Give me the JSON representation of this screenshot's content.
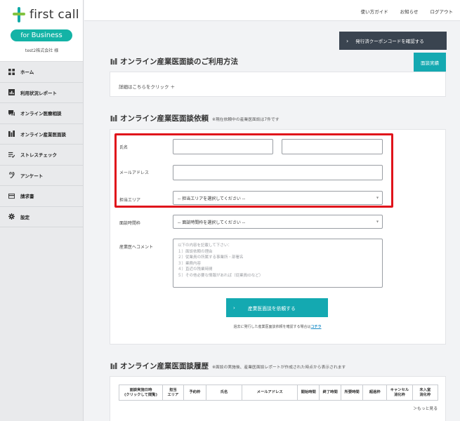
{
  "brand": {
    "name": "first call",
    "badge_prefix": "for",
    "badge_word": "Business",
    "company": "test2株式会社 様"
  },
  "colors": {
    "teal": "#14a9b1",
    "dark_button": "#3a4450",
    "highlight": "#e0131b",
    "link": "#1f8fc9"
  },
  "sidebar": {
    "items": [
      {
        "label": "ホーム",
        "icon": "grid-icon"
      },
      {
        "label": "利用状況レポート",
        "icon": "report-icon"
      },
      {
        "label": "オンライン医療相談",
        "icon": "chat-icon"
      },
      {
        "label": "オンライン産業医面談",
        "icon": "building-icon"
      },
      {
        "label": "ストレスチェック",
        "icon": "checklist-icon"
      },
      {
        "label": "アンケート",
        "icon": "ear-icon"
      },
      {
        "label": "請求書",
        "icon": "card-icon"
      },
      {
        "label": "設定",
        "icon": "gear-icon"
      }
    ]
  },
  "topbar": {
    "guide": "使い方ガイド",
    "news": "お知らせ",
    "logout": "ログアウト"
  },
  "coupon_button": "発行済クーポンコードを確認する",
  "usage": {
    "title": "オンライン産業医面談のご利用方法",
    "interview_button": "面談実績",
    "details_link": "詳細はこちらをクリック ＋"
  },
  "request": {
    "title": "オンライン産業医面談依頼",
    "note": "※現在依頼中の産業医面談は7件です",
    "fields": {
      "name_label": "氏名",
      "email_label": "メールアドレス",
      "area_label": "担当エリア",
      "area_value": "-- 担当エリアを選択してください --",
      "time_label": "面談時間枠",
      "time_value": "-- 面談時間枠を選択してください --",
      "comment_label": "産業医へコメント",
      "comment_placeholder": [
        "以下の内容を記載して下さい：",
        "１）面談依頼の理由",
        "２）従業員の所属する事業所・部署名",
        "３）業務内容",
        "４）直近の残業時間",
        "５）その他必要な情報があれば（従業員IDなど）"
      ]
    },
    "submit": "産業医面談を依頼する",
    "past_note": "過去に発行した産業医面談依頼を確認する場合は",
    "past_link": "コチラ"
  },
  "history": {
    "title": "オンライン産業医面談履歴",
    "note": "※面談の実施後、産業医面談レポートが作成された時点から表示されます",
    "columns": [
      "面談実施日時\n(クリックして閲覧)",
      "担当\nエリア",
      "予約枠",
      "氏名",
      "メールアドレス",
      "開始時間",
      "終了時間",
      "所要時間",
      "超過枠",
      "キャンセル\n消化枠",
      "未入室\n消化枠"
    ],
    "more": "＞もっと見る"
  }
}
